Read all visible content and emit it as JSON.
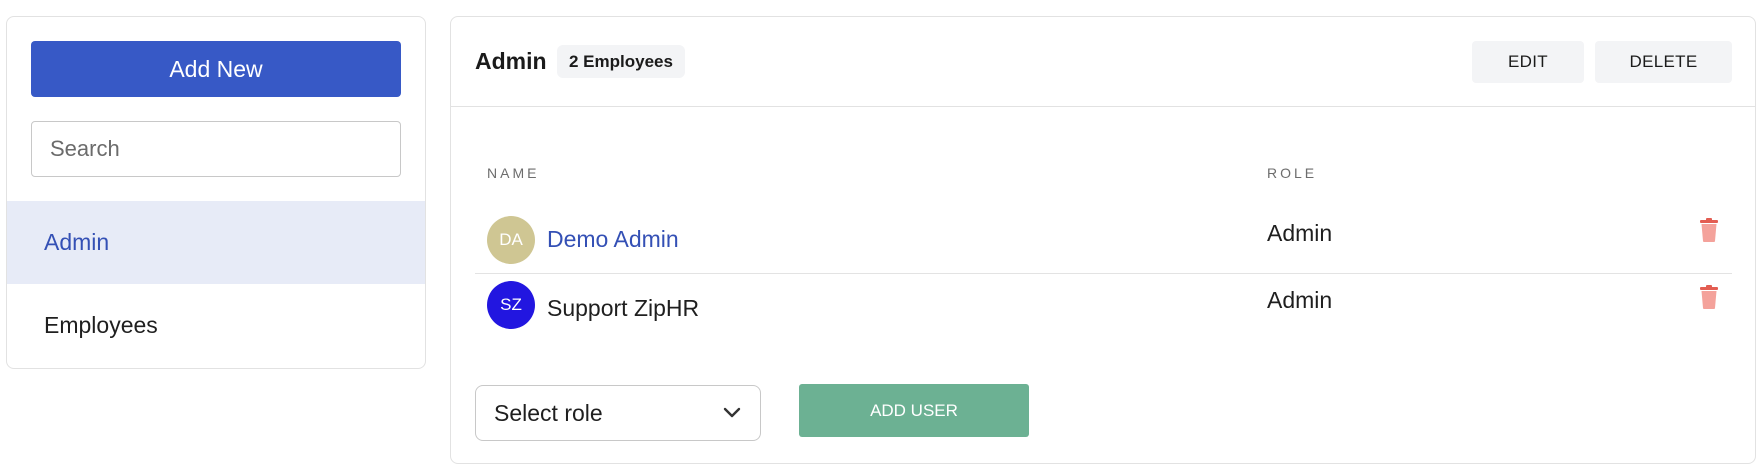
{
  "sidebar": {
    "add_new_label": "Add New",
    "search_placeholder": "Search",
    "groups": [
      {
        "label": "Admin",
        "active": true
      },
      {
        "label": "Employees",
        "active": false
      }
    ]
  },
  "group": {
    "title": "Admin",
    "count_badge": "2 Employees",
    "edit_label": "EDIT",
    "delete_label": "DELETE"
  },
  "table": {
    "headers": {
      "name": "NAME",
      "role": "ROLE"
    },
    "rows": [
      {
        "initials": "DA",
        "name": "Demo Admin",
        "role": "Admin",
        "avatar_color": "#cfc693"
      },
      {
        "initials": "SZ",
        "name": "Support ZipHR",
        "role": "Admin",
        "avatar_color": "#2216e0"
      }
    ]
  },
  "add_user": {
    "select_placeholder": "Select role",
    "button_label": "ADD USER"
  },
  "colors": {
    "primary": "#3759c6",
    "active_bg": "#e7ebf7",
    "add_user_green": "#6cb193",
    "trash": "#f28b82"
  },
  "icons": [
    "trash-icon",
    "chevron-down-icon"
  ]
}
